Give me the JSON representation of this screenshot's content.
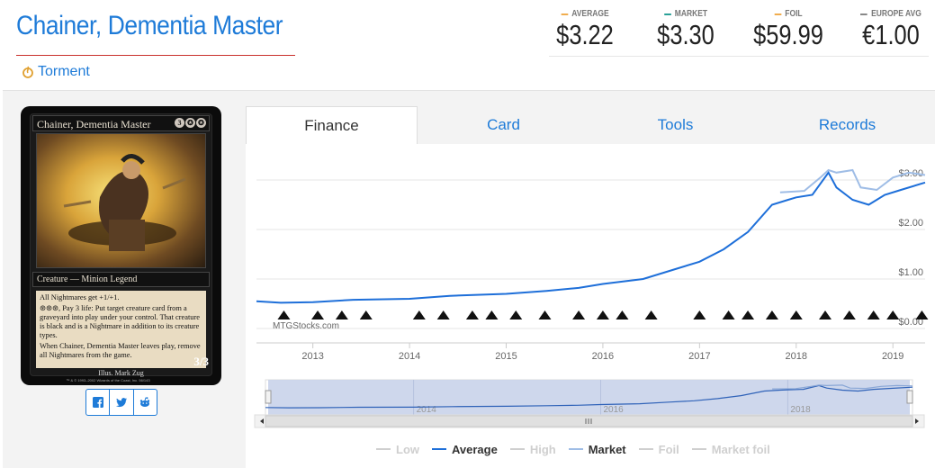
{
  "card": {
    "name": "Chainer, Dementia Master",
    "set": "Torment",
    "image": {
      "name_line": "Chainer, Dementia Master",
      "mana": [
        "3",
        "",
        ""
      ],
      "type_line": "Creature — Minion Legend",
      "rules": [
        "All Nightmares get +1/+1.",
        "⊛⊛⊛, Pay 3 life: Put target creature card from a graveyard into play under your control. That creature is black and is a Nightmare in addition to its creature types.",
        "When Chainer, Dementia Master leaves play, remove all Nightmares from the game."
      ],
      "artist": "Illus. Mark Zug",
      "copyright": "™ & © 1993–2002 Wizards of the Coast, Inc. 56/143",
      "pt": "3/3"
    }
  },
  "prices": [
    {
      "label": "AVERAGE",
      "value": "$3.22",
      "color": "#f0ad4e"
    },
    {
      "label": "MARKET",
      "value": "$3.30",
      "color": "#2aa198"
    },
    {
      "label": "FOIL",
      "value": "$59.99",
      "color": "#f0ad4e"
    },
    {
      "label": "EUROPE AVG",
      "value": "€1.00",
      "color": "#888888"
    }
  ],
  "tabs": [
    {
      "label": "Finance",
      "active": true
    },
    {
      "label": "Card",
      "active": false
    },
    {
      "label": "Tools",
      "active": false
    },
    {
      "label": "Records",
      "active": false
    }
  ],
  "chart_data": {
    "type": "line",
    "watermark": "MTGStocks.com",
    "x_ticks": [
      "2013",
      "2014",
      "2015",
      "2016",
      "2017",
      "2018",
      "2019"
    ],
    "y_ticks": [
      "$0.00",
      "$1.00",
      "$2.00",
      "$3.00"
    ],
    "ylim": [
      0,
      3.4
    ],
    "xlim": [
      "2012-06",
      "2019-05"
    ],
    "navigator_ticks": [
      "2014",
      "2016",
      "2018"
    ],
    "series": [
      {
        "name": "Average",
        "color": "#1e6fd9",
        "points": [
          [
            "2012-06",
            0.55
          ],
          [
            "2012-09",
            0.52
          ],
          [
            "2013-01",
            0.53
          ],
          [
            "2013-06",
            0.58
          ],
          [
            "2014-01",
            0.6
          ],
          [
            "2014-06",
            0.66
          ],
          [
            "2015-01",
            0.7
          ],
          [
            "2015-06",
            0.76
          ],
          [
            "2015-10",
            0.82
          ],
          [
            "2016-01",
            0.9
          ],
          [
            "2016-06",
            1.0
          ],
          [
            "2016-10",
            1.2
          ],
          [
            "2017-01",
            1.35
          ],
          [
            "2017-04",
            1.6
          ],
          [
            "2017-07",
            1.95
          ],
          [
            "2017-10",
            2.5
          ],
          [
            "2017-12",
            2.6
          ],
          [
            "2018-01",
            2.65
          ],
          [
            "2018-03",
            2.7
          ],
          [
            "2018-05",
            3.15
          ],
          [
            "2018-06",
            2.85
          ],
          [
            "2018-08",
            2.6
          ],
          [
            "2018-10",
            2.5
          ],
          [
            "2018-12",
            2.7
          ],
          [
            "2019-02",
            2.8
          ],
          [
            "2019-05",
            2.95
          ]
        ]
      },
      {
        "name": "Market",
        "color": "#9fbde6",
        "points": [
          [
            "2017-11",
            2.75
          ],
          [
            "2018-02",
            2.78
          ],
          [
            "2018-04",
            3.05
          ],
          [
            "2018-05",
            3.2
          ],
          [
            "2018-06",
            3.15
          ],
          [
            "2018-08",
            3.2
          ],
          [
            "2018-09",
            2.85
          ],
          [
            "2018-11",
            2.8
          ],
          [
            "2019-01",
            3.05
          ],
          [
            "2019-03",
            3.15
          ],
          [
            "2019-05",
            3.1
          ]
        ]
      }
    ],
    "legend": [
      {
        "name": "Low",
        "active": false
      },
      {
        "name": "Average",
        "active": true,
        "color": "#1e6fd9"
      },
      {
        "name": "High",
        "active": false
      },
      {
        "name": "Market",
        "active": true,
        "color": "#9fbde6"
      },
      {
        "name": "Foil",
        "active": false
      },
      {
        "name": "Market foil",
        "active": false
      }
    ]
  }
}
